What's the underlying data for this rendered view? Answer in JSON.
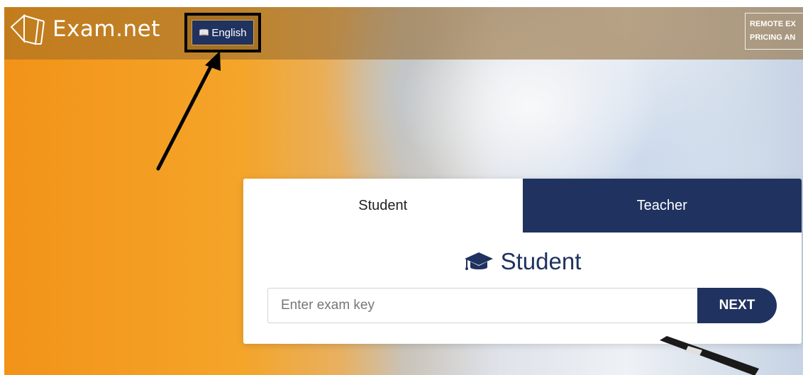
{
  "header": {
    "brand": "Exam.net",
    "language_button": "English",
    "nav_line1": "REMOTE EX",
    "nav_line2": "PRICING AN"
  },
  "card": {
    "tabs": [
      {
        "label": "Student",
        "active": true
      },
      {
        "label": "Teacher",
        "active": false
      }
    ],
    "panel_title": "Student",
    "exam_key_placeholder": "Enter exam key",
    "exam_key_value": "",
    "next_label": "NEXT"
  },
  "colors": {
    "navy": "#1f3260",
    "orange": "#f29318",
    "white": "#ffffff"
  },
  "icons": [
    "logo-mark-icon",
    "book-icon",
    "graduation-cap-icon",
    "arrow-annotation"
  ]
}
